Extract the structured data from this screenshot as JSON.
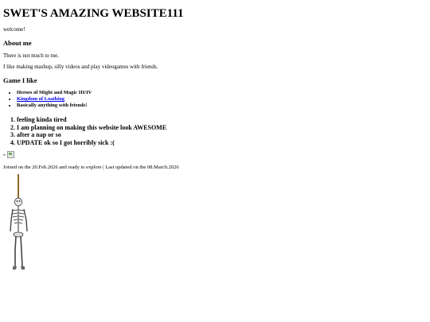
{
  "header": {
    "title": "SWET'S AMAZING WEBSITE111",
    "welcome": "welcome!"
  },
  "about": {
    "heading": "About me",
    "line1": "There is not much to me.",
    "line2": "I like making mashup, silly videos and play videogames with friends."
  },
  "games": {
    "heading": "Game I like",
    "items": [
      {
        "label": "Heroes of Might and Magic III/IV",
        "link": false
      },
      {
        "label": "Kingdom of Loathing",
        "link": true
      },
      {
        "label": "Basically anything with friends!",
        "link": false
      }
    ]
  },
  "status": {
    "items": [
      "feeling kinda tired",
      "I am planning on making this website look AWESOME",
      "after a nap or so",
      "UPDATE ok so I got horribly sick :("
    ]
  },
  "badge": {
    "prefix": "»"
  },
  "footer": {
    "joined_text": "Joined on the 20.Feb.2026 and ready to explore | Last updated on the 08.March.2026"
  },
  "colors": {
    "link": "#0000ee",
    "text": "#000000",
    "background": "#ffffff"
  }
}
